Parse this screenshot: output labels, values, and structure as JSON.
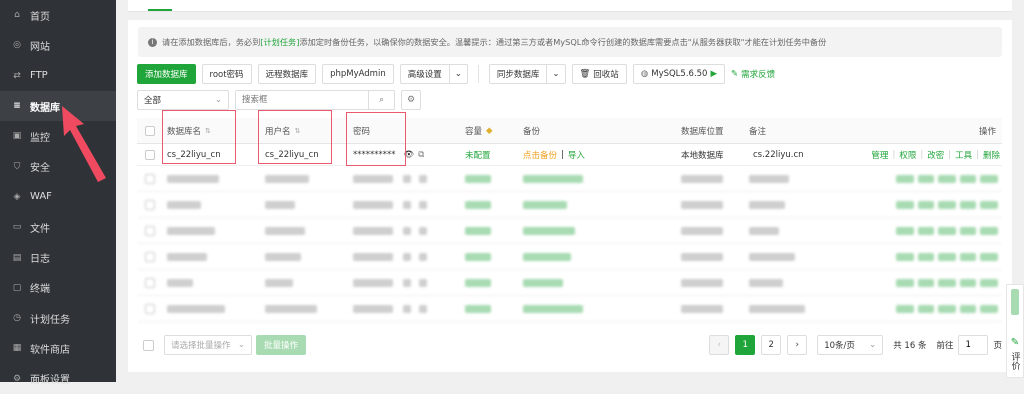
{
  "sidebar": {
    "items": [
      {
        "label": "首页",
        "icon": "home-icon"
      },
      {
        "label": "网站",
        "icon": "globe-icon"
      },
      {
        "label": "FTP",
        "icon": "ftp-icon"
      },
      {
        "label": "数据库",
        "icon": "database-icon",
        "active": true
      },
      {
        "label": "监控",
        "icon": "monitor-icon"
      },
      {
        "label": "安全",
        "icon": "shield-icon"
      },
      {
        "label": "WAF",
        "icon": "waf-icon"
      },
      {
        "label": "文件",
        "icon": "folder-icon"
      },
      {
        "label": "日志",
        "icon": "log-icon"
      },
      {
        "label": "终端",
        "icon": "terminal-icon"
      },
      {
        "label": "计划任务",
        "icon": "clock-icon"
      },
      {
        "label": "软件商店",
        "icon": "store-icon"
      },
      {
        "label": "面板设置",
        "icon": "gear-icon"
      }
    ]
  },
  "notice": {
    "prefix": "请在添加数据库后，务必到",
    "link": "[计划任务]",
    "suffix": "添加定时备份任务，以确保你的数据安全。温馨提示：通过第三方或者MySQL命令行创建的数据库需要点击\"从服务器获取\"才能在计划任务中备份"
  },
  "toolbar": {
    "add_db": "添加数据库",
    "root_pwd": "root密码",
    "remote_db": "远程数据库",
    "phpmyadmin": "phpMyAdmin",
    "advanced": "高级设置",
    "sync_db": "同步数据库",
    "recycle": "回收站",
    "mysql_version": "MySQL5.6.50",
    "feedback": "需求反馈"
  },
  "filter": {
    "category": "全部",
    "search_placeholder": "搜索框"
  },
  "table": {
    "headers": {
      "name": "数据库名",
      "user": "用户名",
      "password": "密码",
      "capacity": "容量",
      "backup": "备份",
      "location": "数据库位置",
      "remark": "备注",
      "actions": "操作"
    },
    "row": {
      "name": "cs_22liyu_cn",
      "user": "cs_22liyu_cn",
      "password": "**********",
      "capacity": "未配置",
      "backup_link": "点击备份",
      "backup_sep": "|",
      "import": "导入",
      "location": "本地数据库",
      "remark": "cs.22liyu.cn",
      "actions": [
        "管理",
        "权限",
        "改密",
        "工具",
        "删除"
      ]
    }
  },
  "footer": {
    "batch_placeholder": "请选择批量操作",
    "batch_button": "批量操作",
    "pages": [
      "1",
      "2"
    ],
    "current_page": "1",
    "per_page": "10条/页",
    "total": "共 16 条",
    "goto_label": "前往",
    "goto_value": "1",
    "page_unit": "页"
  },
  "side_tools": {
    "evaluate": "评价"
  }
}
